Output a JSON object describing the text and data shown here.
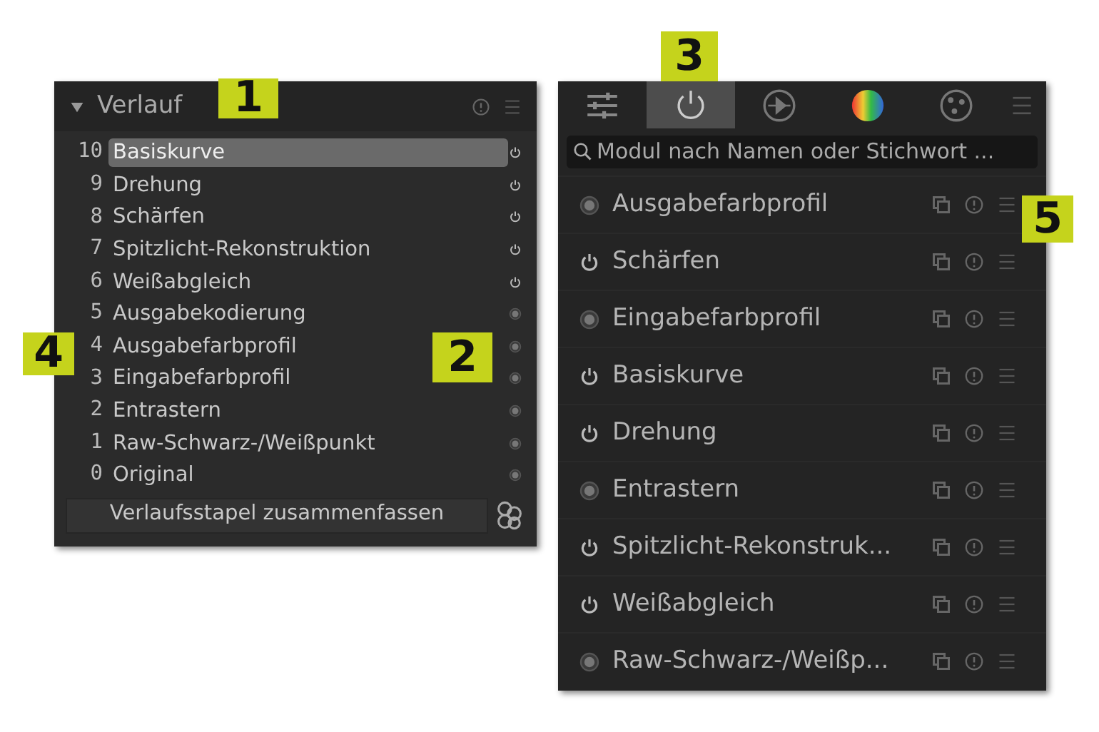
{
  "history": {
    "title": "Verlauf",
    "expanded": true,
    "items": [
      {
        "number": "10",
        "name": "Basiskurve",
        "selected": true,
        "kind": "power"
      },
      {
        "number": "9",
        "name": "Drehung",
        "selected": false,
        "kind": "power"
      },
      {
        "number": "8",
        "name": "Schärfen",
        "selected": false,
        "kind": "power"
      },
      {
        "number": "7",
        "name": "Spitzlicht-Rekonstruktion",
        "selected": false,
        "kind": "power"
      },
      {
        "number": "6",
        "name": "Weißabgleich",
        "selected": false,
        "kind": "power"
      },
      {
        "number": "5",
        "name": "Ausgabekodierung",
        "selected": false,
        "kind": "always-on"
      },
      {
        "number": "4",
        "name": "Ausgabefarbprofil",
        "selected": false,
        "kind": "always-on"
      },
      {
        "number": "3",
        "name": "Eingabefarbprofil",
        "selected": false,
        "kind": "always-on"
      },
      {
        "number": "2",
        "name": "Entrastern",
        "selected": false,
        "kind": "always-on"
      },
      {
        "number": "1",
        "name": "Raw-Schwarz-/Weißpunkt",
        "selected": false,
        "kind": "always-on"
      },
      {
        "number": "0",
        "name": "Original",
        "selected": false,
        "kind": "always-on"
      }
    ],
    "compress_button": "Verlaufsstapel zusammenfassen"
  },
  "modules": {
    "tabs": [
      {
        "kind": "sliders",
        "selected": false
      },
      {
        "kind": "power",
        "selected": true
      },
      {
        "kind": "signal",
        "selected": false
      },
      {
        "kind": "color",
        "selected": false
      },
      {
        "kind": "effects",
        "selected": false
      }
    ],
    "search": {
      "placeholder": "Modul nach Namen oder Stichwort ..."
    },
    "items": [
      {
        "name": "Ausgabefarbprofil",
        "kind": "always-on"
      },
      {
        "name": "Schärfen",
        "kind": "power"
      },
      {
        "name": "Eingabefarbprofil",
        "kind": "always-on"
      },
      {
        "name": "Basiskurve",
        "kind": "power"
      },
      {
        "name": "Drehung",
        "kind": "power"
      },
      {
        "name": "Entrastern",
        "kind": "always-on"
      },
      {
        "name": "Spitzlicht-Rekonstruk...",
        "kind": "power"
      },
      {
        "name": "Weißabgleich",
        "kind": "power"
      },
      {
        "name": "Raw-Schwarz-/Weißp...",
        "kind": "always-on"
      }
    ]
  },
  "callouts": [
    {
      "label": "1",
      "kind": "history-header"
    },
    {
      "label": "2",
      "kind": "history-icons"
    },
    {
      "label": "3",
      "kind": "power-tab"
    },
    {
      "label": "4",
      "kind": "history-numbers"
    },
    {
      "label": "5",
      "kind": "module-menu"
    }
  ]
}
